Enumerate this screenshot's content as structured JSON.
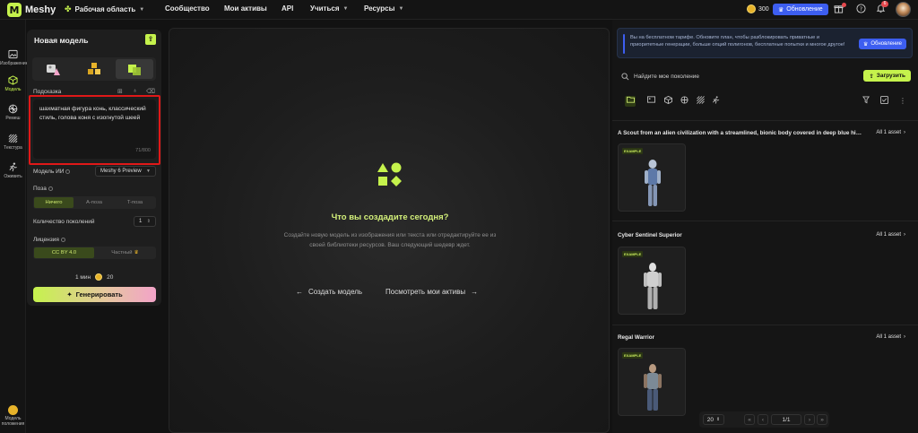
{
  "brand": {
    "name": "Meshy"
  },
  "nav": {
    "workspace": "Рабочая область",
    "community": "Сообщество",
    "my_assets": "Мои активы",
    "api": "API",
    "learn": "Учиться",
    "resources": "Ресурсы",
    "credits": "300",
    "upgrade": "Обновление",
    "notifications_badge": "6"
  },
  "rail": {
    "items": [
      {
        "label": "Изображение",
        "icon": "image-icon"
      },
      {
        "label": "Модель",
        "icon": "cube-icon"
      },
      {
        "label": "Ремеш",
        "icon": "remesh-icon"
      },
      {
        "label": "Текстура",
        "icon": "texture-icon"
      },
      {
        "label": "Оживить",
        "icon": "run-icon"
      }
    ],
    "bottom_label": "Модель положения"
  },
  "left": {
    "title": "Новая модель",
    "hint_label": "Подсказка",
    "prompt_text": "шахматная фигура конь, классический стиль, голова коня с изогнутой шеей",
    "prompt_count": "71/800",
    "ai_model_label": "Модель ИИ",
    "ai_model_value": "Meshy 6 Preview",
    "pose_label": "Поза",
    "pose_options": [
      "Ничего",
      "A-поза",
      "T-поза"
    ],
    "count_label": "Количество поколений",
    "count_value": "1",
    "license_label": "Лицензия",
    "license_options": [
      "CC BY 4.0",
      "Частный"
    ],
    "time": "1 мин",
    "cost": "20",
    "generate": "Генерировать"
  },
  "center": {
    "title": "Что вы создадите сегодня?",
    "description": "Создайте новую модель из изображения или текста или отредактируйте ее из своей библиотеки ресурсов. Ваш следующий шедевр ждет.",
    "create_link": "Создать модель",
    "assets_link": "Посмотреть мои активы"
  },
  "right": {
    "banner": "Вы на бесплатном тарифе. Обновите план, чтобы разблокировать приватные и приоритетные генерации, больше опций полигонов, бесплатные попытки и многое другое!",
    "banner_button": "Обновление",
    "search_placeholder": "Найдите мое поколение",
    "upload": "Загрузить",
    "badge": "EXAMPLE",
    "cards": [
      {
        "title": "A Scout from an alien civilization with a streamlined, bionic body covered in deep blue high-tech armor",
        "all": "All 1 asset"
      },
      {
        "title": "Cyber Sentinel Superior",
        "all": "All 1 asset"
      },
      {
        "title": "Regal Warrior",
        "all": "All 1 asset"
      }
    ],
    "page_size": "20",
    "page": "1/1"
  }
}
